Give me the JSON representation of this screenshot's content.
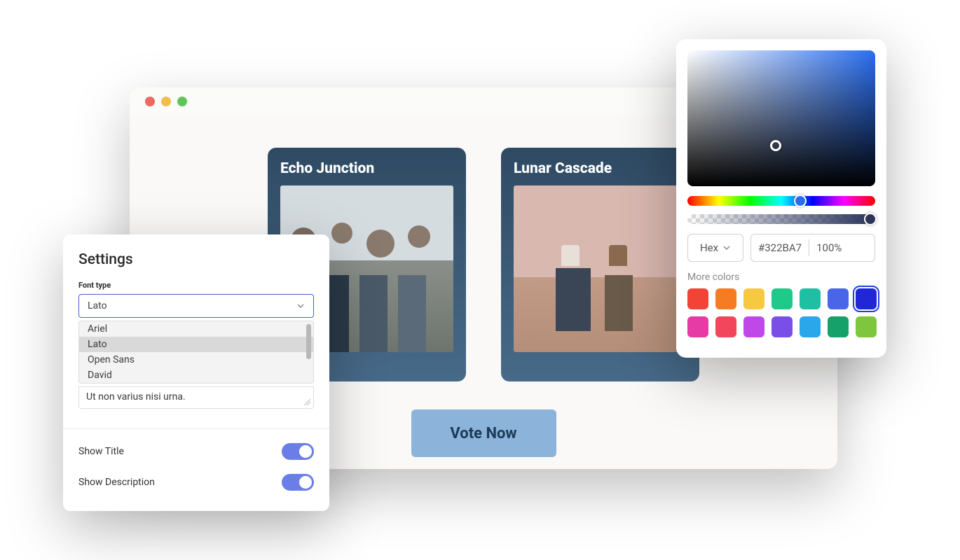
{
  "browser": {
    "cards": [
      {
        "title": "Echo Junction"
      },
      {
        "title": "Lunar Cascade"
      }
    ],
    "vote_button": "Vote Now"
  },
  "settings": {
    "title": "Settings",
    "font_label": "Font type",
    "font_selected": "Lato",
    "font_options": [
      "Ariel",
      "Lato",
      "Open Sans",
      "David"
    ],
    "textarea_value": "Ut non varius nisi urna.",
    "show_title_label": "Show Title",
    "show_title_on": true,
    "show_description_label": "Show Description",
    "show_description_on": true
  },
  "picker": {
    "format_label": "Hex",
    "hex_value": "#322BA7",
    "alpha_value": "100%",
    "more_colors_label": "More colors",
    "swatches": [
      "#f24336",
      "#f57c23",
      "#f6c940",
      "#1ec989",
      "#1fbfa4",
      "#4a66e8",
      "#2127d6",
      "#e63aa5",
      "#f1465c",
      "#c048e8",
      "#7a4fe8",
      "#2aa7ea",
      "#16a16b",
      "#7ec63e"
    ],
    "selected_swatch_index": 6
  }
}
